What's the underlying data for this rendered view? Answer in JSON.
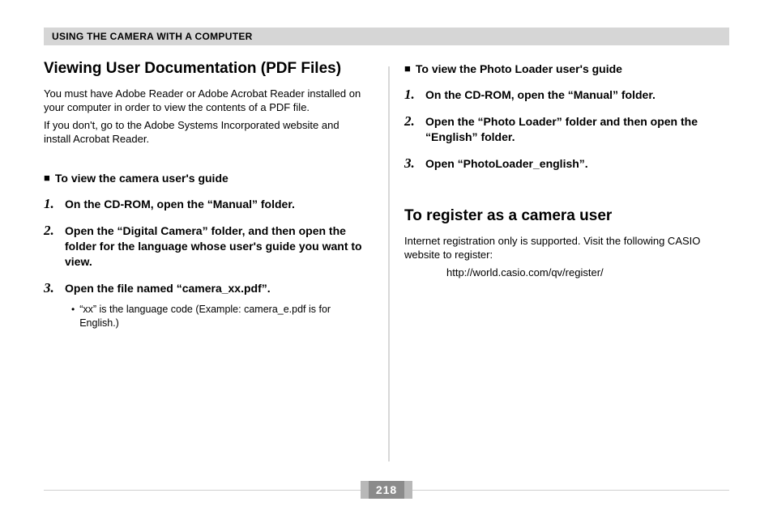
{
  "header": {
    "title": "USING THE CAMERA WITH A COMPUTER"
  },
  "left": {
    "heading": "Viewing User Documentation (PDF Files)",
    "intro1": "You must have Adobe Reader or Adobe Acrobat Reader installed on your computer in order to view the contents of a PDF file.",
    "intro2": "If you don't, go to the Adobe Systems Incorporated website and install Acrobat Reader.",
    "sub": "To view the camera user's guide",
    "steps": [
      {
        "n": "1.",
        "text": "On the CD-ROM, open the “Manual” folder."
      },
      {
        "n": "2.",
        "text": "Open the  “Digital Camera” folder, and then open the folder for the language whose user's guide you want to view."
      },
      {
        "n": "3.",
        "text": "Open the file named “camera_xx.pdf”."
      }
    ],
    "note": "“xx” is the language code (Example: camera_e.pdf is for English.)"
  },
  "right": {
    "sub": "To view the Photo Loader user's guide",
    "steps": [
      {
        "n": "1.",
        "text": "On the CD-ROM, open the “Manual” folder."
      },
      {
        "n": "2.",
        "text": "Open the “Photo Loader” folder and then open the “English” folder."
      },
      {
        "n": "3.",
        "text": "Open “PhotoLoader_english”."
      }
    ],
    "reg": {
      "heading": "To register as a camera user",
      "body": "Internet registration only is supported. Visit the following CASIO website to register:",
      "url": "http://world.casio.com/qv/register/"
    }
  },
  "page_number": "218"
}
